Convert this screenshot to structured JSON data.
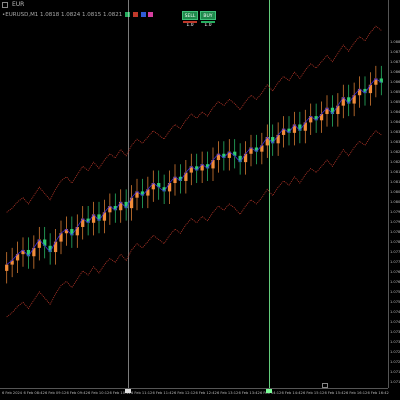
{
  "window": {
    "title": "EUR"
  },
  "info": {
    "text": "•EURUSD,M1 1.0818 1.0824 1.0815 1.0821"
  },
  "trade_panel": {
    "sell_label": "SELL 1.0",
    "buy_label": "BUY 1.0"
  },
  "price_labels": [
    "1.0880",
    "1.0875",
    "1.0870",
    "1.0865",
    "1.0860",
    "1.0855",
    "1.0850",
    "1.0845",
    "1.0840",
    "1.0835",
    "1.0830",
    "1.0825",
    "1.0820",
    "1.0815",
    "1.0810",
    "1.0805",
    "1.0800",
    "1.0795",
    "1.0790",
    "1.0785",
    "1.0780",
    "1.0775",
    "1.0770",
    "1.0765",
    "1.0760",
    "1.0755",
    "1.0750",
    "1.0745",
    "1.0740",
    "1.0735",
    "1.0730",
    "1.0725",
    "1.0720",
    "1.0715",
    "1.0710"
  ],
  "time_labels": [
    "6 Feb 2024",
    "6 Feb 08:42",
    "6 Feb 09:12",
    "6 Feb 09:42",
    "6 Feb 10:12",
    "6 Feb 10:42",
    "6 Feb 11:12",
    "6 Feb 11:42",
    "6 Feb 12:12",
    "6 Feb 12:42",
    "6 Feb 13:12",
    "6 Feb 13:42",
    "6 Feb 14:12",
    "6 Feb 14:42",
    "6 Feb 15:12",
    "6 Feb 15:42",
    "6 Feb 16:12",
    "6 Feb 16:42"
  ],
  "colors": {
    "background": "#000000",
    "bull": "#f28c3a",
    "bear": "#2ecc71",
    "band": "#c0392b",
    "mid": "#3a2bd6",
    "sep_green": "#7dff9a",
    "sep_white": "#e0e0e0",
    "swatch_green": "#27ae60",
    "swatch_red": "#c0392b",
    "swatch_blue": "#2f5bd6",
    "swatch_pink": "#d63fa0"
  },
  "chart_data": {
    "type": "candlestick",
    "series": [
      {
        "name": "price",
        "values": [
          1.0764,
          1.0766,
          1.0769,
          1.0771,
          1.0768,
          1.0772,
          1.0776,
          1.0773,
          1.077,
          1.0775,
          1.0779,
          1.0781,
          1.0778,
          1.0782,
          1.0786,
          1.0784,
          1.0788,
          1.0785,
          1.0789,
          1.0792,
          1.079,
          1.0794,
          1.0791,
          1.0796,
          1.0799,
          1.0797,
          1.08,
          1.0803,
          1.0801,
          1.0799,
          1.0803,
          1.0806,
          1.0804,
          1.0808,
          1.0811,
          1.0809,
          1.0812,
          1.081,
          1.0814,
          1.0817,
          1.0815,
          1.0818,
          1.0816,
          1.0813,
          1.0817,
          1.082,
          1.0818,
          1.0821,
          1.0825,
          1.0822,
          1.0826,
          1.0829,
          1.0827,
          1.0831,
          1.0828,
          1.0832,
          1.0835,
          1.0833,
          1.0836,
          1.0839,
          1.0836,
          1.084,
          1.0844,
          1.0841,
          1.0845,
          1.0848,
          1.0846,
          1.085,
          1.0853,
          1.0851
        ]
      }
    ]
  }
}
